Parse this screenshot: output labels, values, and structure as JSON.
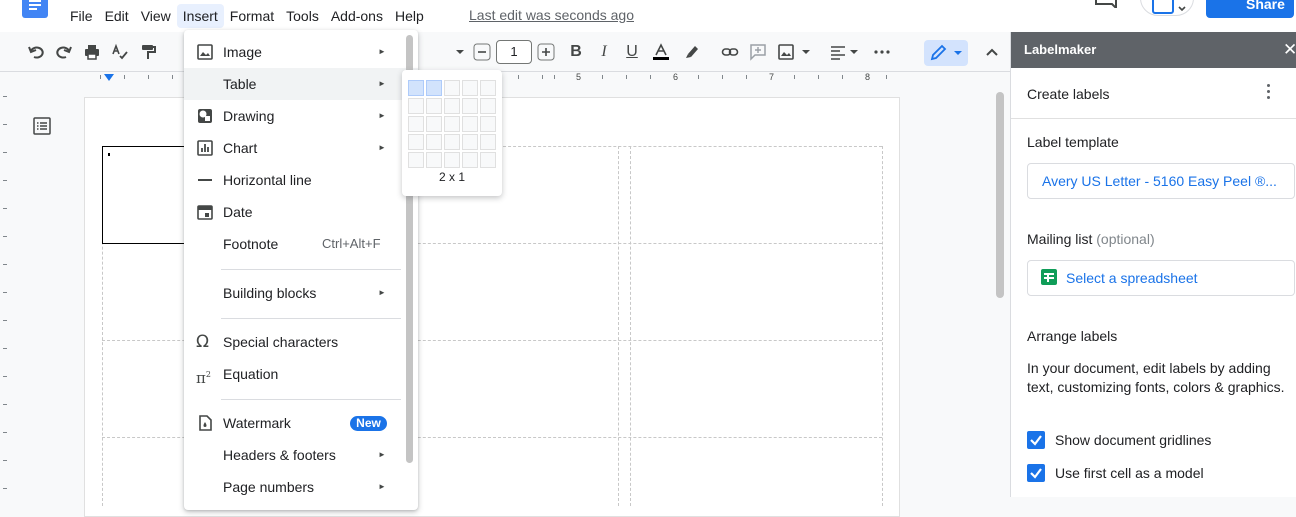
{
  "menubar": {
    "items": [
      "File",
      "Edit",
      "View",
      "Insert",
      "Format",
      "Tools",
      "Add-ons",
      "Help"
    ],
    "active": "Insert",
    "last_edit": "Last edit was seconds ago"
  },
  "header": {
    "share_label": "Share"
  },
  "toolbar": {
    "font_size": "1"
  },
  "ruler": {
    "numbers": [
      "5",
      "6",
      "7",
      "8"
    ]
  },
  "insert_menu": {
    "image": "Image",
    "table": "Table",
    "drawing": "Drawing",
    "chart": "Chart",
    "horizontal_line": "Horizontal line",
    "date": "Date",
    "footnote": "Footnote",
    "footnote_shortcut": "Ctrl+Alt+F",
    "building_blocks": "Building blocks",
    "special_characters": "Special characters",
    "equation": "Equation",
    "watermark": "Watermark",
    "watermark_badge": "New",
    "headers_footers": "Headers & footers",
    "page_numbers": "Page numbers"
  },
  "table_grid": {
    "size_label": "2 x 1",
    "rows": 5,
    "cols": 5,
    "selected_rows": 1,
    "selected_cols": 2
  },
  "panel": {
    "title": "Labelmaker",
    "close": "✕",
    "create_labels": "Create labels",
    "label_template_heading": "Label template",
    "label_template_value": "Avery US Letter - 5160 Easy Peel ®...",
    "mailing_list_heading": "Mailing list",
    "mailing_list_optional": "(optional)",
    "select_spreadsheet": "Select a spreadsheet",
    "arrange_heading": "Arrange labels",
    "arrange_desc": "In your document, edit labels by adding text, customizing fonts, colors & graphics.",
    "show_gridlines": "Show document gridlines",
    "use_first_cell": "Use first cell as a model"
  },
  "colors": {
    "accent": "#1a73e8",
    "panel_header": "#5f6368",
    "sheets_green": "#0f9d58"
  }
}
